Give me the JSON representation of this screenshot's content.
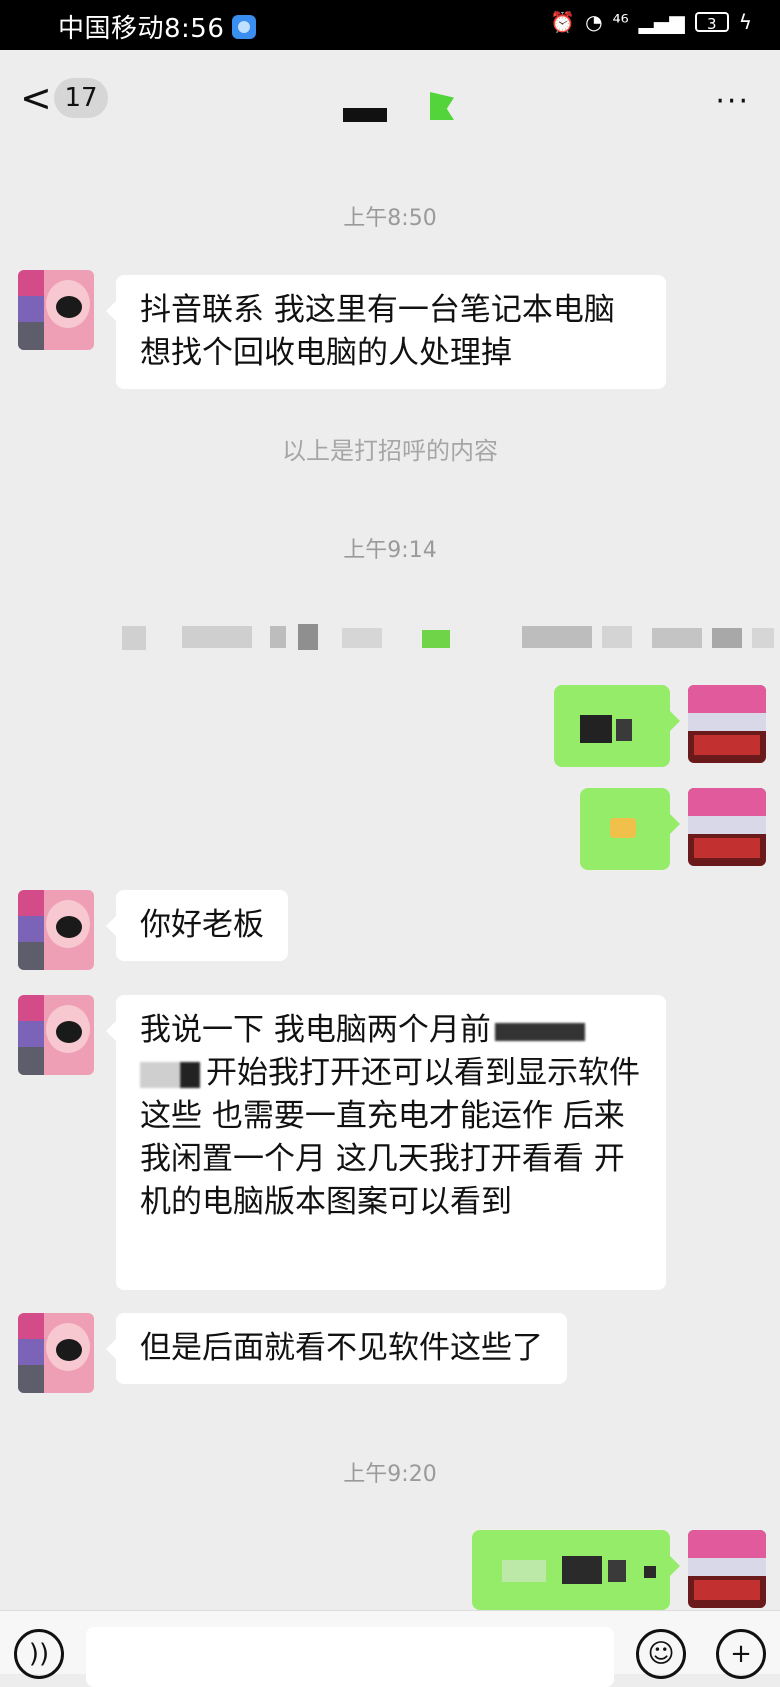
{
  "status_bar": {
    "carrier_time": "中国移动8:56",
    "network": "⁴⁶",
    "battery": "3"
  },
  "header": {
    "back_symbol": "<",
    "unread_count": "17",
    "more": "···"
  },
  "messages": {
    "t1": "上午8:50",
    "m1": "抖音联系 我这里有一台笔记本电脑 想找个回收电脑的人处理掉",
    "sys1": "以上是打招呼的内容",
    "t2": "上午9:14",
    "m_ni_hao": "你好老板",
    "m_long_start": "我说一下 我电脑两个月前",
    "m_long_rest": "开始我打开还可以看到显示软件这些 也需要一直充电才能运作 后来我闲置一个月 这几天我打开看看 开机的电脑版本图案可以看到",
    "m_last": "但是后面就看不见软件这些了",
    "t3": "上午9:20"
  },
  "icons": {
    "voice": "voice-icon",
    "emoji": "emoji-icon",
    "plus": "plus-icon"
  },
  "colors": {
    "my_bubble": "#95ec69",
    "background": "#ededed"
  }
}
